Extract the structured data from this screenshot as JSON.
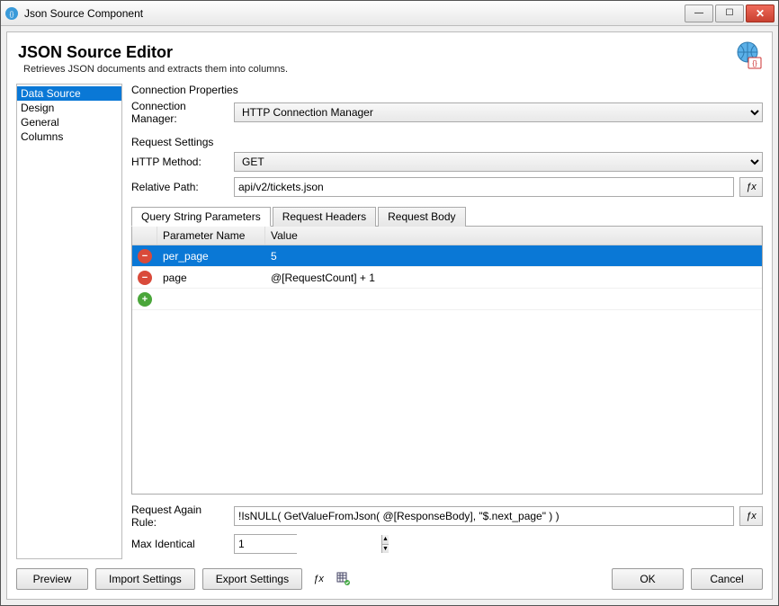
{
  "window": {
    "title": "Json Source Component"
  },
  "header": {
    "title": "JSON Source Editor",
    "subtitle": "Retrieves JSON documents and extracts them into columns."
  },
  "sidebar": {
    "items": [
      {
        "label": "Data Source"
      },
      {
        "label": "Design"
      },
      {
        "label": "General"
      },
      {
        "label": "Columns"
      }
    ],
    "selectedIndex": 0
  },
  "connectionProperties": {
    "groupLabel": "Connection Properties",
    "connectionManagerLabel": "Connection Manager:",
    "connectionManagerValue": "HTTP Connection Manager"
  },
  "requestSettings": {
    "groupLabel": "Request Settings",
    "httpMethodLabel": "HTTP Method:",
    "httpMethodValue": "GET",
    "relativePathLabel": "Relative Path:",
    "relativePathValue": "api/v2/tickets.json"
  },
  "paramTabs": {
    "tabs": [
      {
        "label": "Query String Parameters"
      },
      {
        "label": "Request Headers"
      },
      {
        "label": "Request Body"
      }
    ],
    "activeIndex": 0,
    "columns": {
      "name": "Parameter Name",
      "value": "Value"
    },
    "rows": [
      {
        "name": "per_page",
        "value": "5",
        "selected": true
      },
      {
        "name": "page",
        "value": "@[RequestCount] + 1",
        "selected": false
      }
    ]
  },
  "requestAgain": {
    "label": "Request Again Rule:",
    "value": "!IsNULL( GetValueFromJson( @[ResponseBody], \"$.next_page\" ) )"
  },
  "maxIdentical": {
    "label": "Max Identical",
    "value": "1"
  },
  "footer": {
    "preview": "Preview",
    "importSettings": "Import Settings",
    "exportSettings": "Export Settings",
    "ok": "OK",
    "cancel": "Cancel",
    "fx": "ƒx"
  },
  "fxLabel": "ƒx"
}
